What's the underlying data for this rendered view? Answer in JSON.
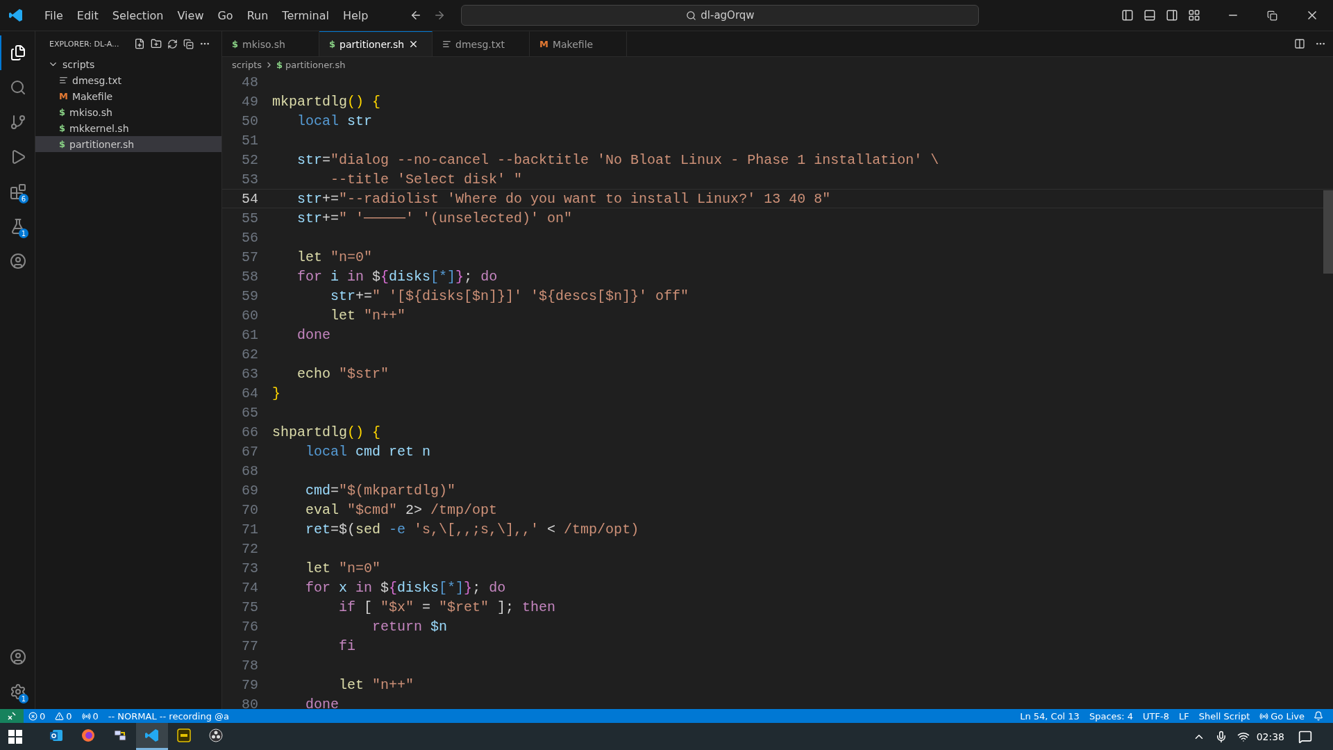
{
  "menu": [
    "File",
    "Edit",
    "Selection",
    "View",
    "Go",
    "Run",
    "Terminal",
    "Help"
  ],
  "command_center": {
    "text": "dl-agOrqw"
  },
  "activity_bar": [
    {
      "kind": "files",
      "selected": true
    },
    {
      "kind": "search",
      "selected": false
    },
    {
      "kind": "git",
      "selected": false
    },
    {
      "kind": "debug",
      "selected": false
    },
    {
      "kind": "extensions",
      "selected": false,
      "badge": "6"
    },
    {
      "kind": "testing",
      "selected": false,
      "badge": "1"
    },
    {
      "kind": "remote",
      "selected": false
    }
  ],
  "activity_bottom": [
    {
      "kind": "account"
    },
    {
      "kind": "settings",
      "badge": "1"
    }
  ],
  "explorer": {
    "title": "EXPLORER: DL-A...",
    "folder": {
      "name": "scripts",
      "expanded": true,
      "children": [
        {
          "name": "dmesg.txt",
          "kind": "txt",
          "selected": false
        },
        {
          "name": "Makefile",
          "kind": "make",
          "icon": "M",
          "selected": false
        },
        {
          "name": "mkiso.sh",
          "kind": "sh",
          "icon": "$",
          "selected": false
        },
        {
          "name": "mkkernel.sh",
          "kind": "sh",
          "icon": "$",
          "selected": false
        },
        {
          "name": "partitioner.sh",
          "kind": "sh",
          "icon": "$",
          "selected": true
        }
      ]
    }
  },
  "tabs": [
    {
      "label": "mkiso.sh",
      "kind": "sh",
      "icon": "$",
      "selected": false
    },
    {
      "label": "partitioner.sh",
      "kind": "sh",
      "icon": "$",
      "selected": true
    },
    {
      "label": "dmesg.txt",
      "kind": "txt",
      "selected": false
    },
    {
      "label": "Makefile",
      "kind": "make",
      "icon": "M",
      "selected": false
    }
  ],
  "breadcrumb": [
    {
      "label": "scripts",
      "kind": "folder"
    },
    {
      "label": "partitioner.sh",
      "kind": "sh",
      "icon": "$"
    }
  ],
  "code": [
    {
      "number": "48",
      "current": false
    },
    {
      "number": "49",
      "current": false,
      "tokens": [
        {
          "kind": "fn",
          "text": "mkpartdlg"
        },
        {
          "kind": "br",
          "text": "() {"
        }
      ]
    },
    {
      "number": "50",
      "current": false,
      "tokens": [
        {
          "kind": "kw",
          "text": "   local"
        },
        {
          "kind": "var",
          "text": " str"
        }
      ]
    },
    {
      "number": "51",
      "current": false
    },
    {
      "number": "52",
      "current": false,
      "tokens": [
        {
          "kind": "var",
          "text": "   str"
        },
        {
          "kind": "op",
          "text": "="
        },
        {
          "kind": "str",
          "text": "\"dialog --no-cancel --backtitle 'No Bloat Linux - Phase 1 installation' \\"
        }
      ]
    },
    {
      "number": "53",
      "current": false,
      "tokens": [
        {
          "kind": "str",
          "text": "       --title 'Select disk' \""
        }
      ]
    },
    {
      "number": "54",
      "current": true,
      "tokens": [
        {
          "kind": "var",
          "text": "   str"
        },
        {
          "kind": "op",
          "text": "+="
        },
        {
          "kind": "str",
          "text": "\"--radiolist 'Where do you want to install Linux?' 13 40 8\""
        }
      ]
    },
    {
      "number": "55",
      "current": false,
      "tokens": [
        {
          "kind": "var",
          "text": "   str"
        },
        {
          "kind": "op",
          "text": "+="
        },
        {
          "kind": "str",
          "text": "\" '─────' '(unselected)' on\""
        }
      ]
    },
    {
      "number": "56",
      "current": false
    },
    {
      "number": "57",
      "current": false,
      "tokens": [
        {
          "kind": "fn",
          "text": "   let"
        },
        {
          "kind": "str",
          "text": " \"n=0\""
        }
      ]
    },
    {
      "number": "58",
      "current": false,
      "tokens": [
        {
          "kind": "ctl",
          "text": "   for"
        },
        {
          "kind": "var",
          "text": " i"
        },
        {
          "kind": "ctl",
          "text": " in"
        },
        {
          "kind": "op",
          "text": " $"
        },
        {
          "kind": "br2",
          "text": "{"
        },
        {
          "kind": "var",
          "text": "disks"
        },
        {
          "kind": "kw",
          "text": "[*]"
        },
        {
          "kind": "br2",
          "text": "}"
        },
        {
          "kind": "op",
          "text": ";"
        },
        {
          "kind": "ctl",
          "text": " do"
        }
      ]
    },
    {
      "number": "59",
      "current": false,
      "tokens": [
        {
          "kind": "var",
          "text": "       str"
        },
        {
          "kind": "op",
          "text": "+="
        },
        {
          "kind": "str",
          "text": "\" '[${disks[$n]}]' '${descs[$n]}' off\""
        }
      ]
    },
    {
      "number": "60",
      "current": false,
      "tokens": [
        {
          "kind": "fn",
          "text": "       let"
        },
        {
          "kind": "str",
          "text": " \"n++\""
        }
      ]
    },
    {
      "number": "61",
      "current": false,
      "tokens": [
        {
          "kind": "ctl",
          "text": "   done"
        }
      ]
    },
    {
      "number": "62",
      "current": false
    },
    {
      "number": "63",
      "current": false,
      "tokens": [
        {
          "kind": "fn",
          "text": "   echo"
        },
        {
          "kind": "str",
          "text": " \"$str\""
        }
      ]
    },
    {
      "number": "64",
      "current": false,
      "tokens": [
        {
          "kind": "br",
          "text": "}"
        }
      ]
    },
    {
      "number": "65",
      "current": false
    },
    {
      "number": "66",
      "current": false,
      "tokens": [
        {
          "kind": "fn",
          "text": "shpartdlg"
        },
        {
          "kind": "br",
          "text": "() {"
        }
      ]
    },
    {
      "number": "67",
      "current": false,
      "tokens": [
        {
          "kind": "kw",
          "text": "    local"
        },
        {
          "kind": "var",
          "text": " cmd ret n"
        }
      ]
    },
    {
      "number": "68",
      "current": false
    },
    {
      "number": "69",
      "current": false,
      "tokens": [
        {
          "kind": "var",
          "text": "    cmd"
        },
        {
          "kind": "op",
          "text": "="
        },
        {
          "kind": "str",
          "text": "\"$(mkpartdlg)\""
        }
      ]
    },
    {
      "number": "70",
      "current": false,
      "tokens": [
        {
          "kind": "fn",
          "text": "    eval"
        },
        {
          "kind": "str",
          "text": " \"$cmd\""
        },
        {
          "kind": "op",
          "text": " 2>"
        },
        {
          "kind": "str",
          "text": " /tmp/opt"
        }
      ]
    },
    {
      "number": "71",
      "current": false,
      "tokens": [
        {
          "kind": "var",
          "text": "    ret"
        },
        {
          "kind": "op",
          "text": "=$("
        },
        {
          "kind": "fn",
          "text": "sed"
        },
        {
          "kind": "kw",
          "text": " -e"
        },
        {
          "kind": "str",
          "text": " 's,\\[,,;s,\\],,'"
        },
        {
          "kind": "op",
          "text": " <"
        },
        {
          "kind": "str",
          "text": " /tmp/opt)"
        }
      ]
    },
    {
      "number": "72",
      "current": false
    },
    {
      "number": "73",
      "current": false,
      "tokens": [
        {
          "kind": "fn",
          "text": "    let"
        },
        {
          "kind": "str",
          "text": " \"n=0\""
        }
      ]
    },
    {
      "number": "74",
      "current": false,
      "tokens": [
        {
          "kind": "ctl",
          "text": "    for"
        },
        {
          "kind": "var",
          "text": " x"
        },
        {
          "kind": "ctl",
          "text": " in"
        },
        {
          "kind": "op",
          "text": " $"
        },
        {
          "kind": "br2",
          "text": "{"
        },
        {
          "kind": "var",
          "text": "disks"
        },
        {
          "kind": "kw",
          "text": "[*]"
        },
        {
          "kind": "br2",
          "text": "}"
        },
        {
          "kind": "op",
          "text": ";"
        },
        {
          "kind": "ctl",
          "text": " do"
        }
      ]
    },
    {
      "number": "75",
      "current": false,
      "tokens": [
        {
          "kind": "ctl",
          "text": "        if"
        },
        {
          "kind": "op",
          "text": " ["
        },
        {
          "kind": "str",
          "text": " \"$x\""
        },
        {
          "kind": "op",
          "text": " ="
        },
        {
          "kind": "str",
          "text": " \"$ret\""
        },
        {
          "kind": "op",
          "text": " ];"
        },
        {
          "kind": "ctl",
          "text": " then"
        }
      ]
    },
    {
      "number": "76",
      "current": false,
      "tokens": [
        {
          "kind": "ctl",
          "text": "            return"
        },
        {
          "kind": "var",
          "text": " $n"
        }
      ]
    },
    {
      "number": "77",
      "current": false,
      "tokens": [
        {
          "kind": "ctl",
          "text": "        fi"
        }
      ]
    },
    {
      "number": "78",
      "current": false
    },
    {
      "number": "79",
      "current": false,
      "tokens": [
        {
          "kind": "fn",
          "text": "        let"
        },
        {
          "kind": "str",
          "text": " \"n++\""
        }
      ]
    },
    {
      "number": "80",
      "current": false,
      "tokens": [
        {
          "kind": "ctl",
          "text": "    done"
        }
      ]
    }
  ],
  "status_bar": {
    "left": [
      {
        "kind": "errors",
        "text": "0"
      },
      {
        "kind": "warnings",
        "text": "0"
      },
      {
        "kind": "ports",
        "text": "0"
      },
      {
        "kind": "plain",
        "text": "-- NORMAL -- recording @a"
      }
    ],
    "right": [
      {
        "kind": "plain",
        "text": "Ln 54, Col 13"
      },
      {
        "kind": "plain",
        "text": "Spaces: 4"
      },
      {
        "kind": "plain",
        "text": "UTF-8"
      },
      {
        "kind": "plain",
        "text": "LF"
      },
      {
        "kind": "plain",
        "text": "Shell Script"
      },
      {
        "kind": "live",
        "text": "Go Live"
      }
    ]
  },
  "taskbar": {
    "apps": [
      {
        "kind": "outlook",
        "active": false
      },
      {
        "kind": "firefox",
        "active": false
      },
      {
        "kind": "network",
        "active": false
      },
      {
        "kind": "vscode",
        "active": true
      },
      {
        "kind": "scp",
        "active": false
      },
      {
        "kind": "obs",
        "active": false
      }
    ],
    "clock": "02:38"
  }
}
